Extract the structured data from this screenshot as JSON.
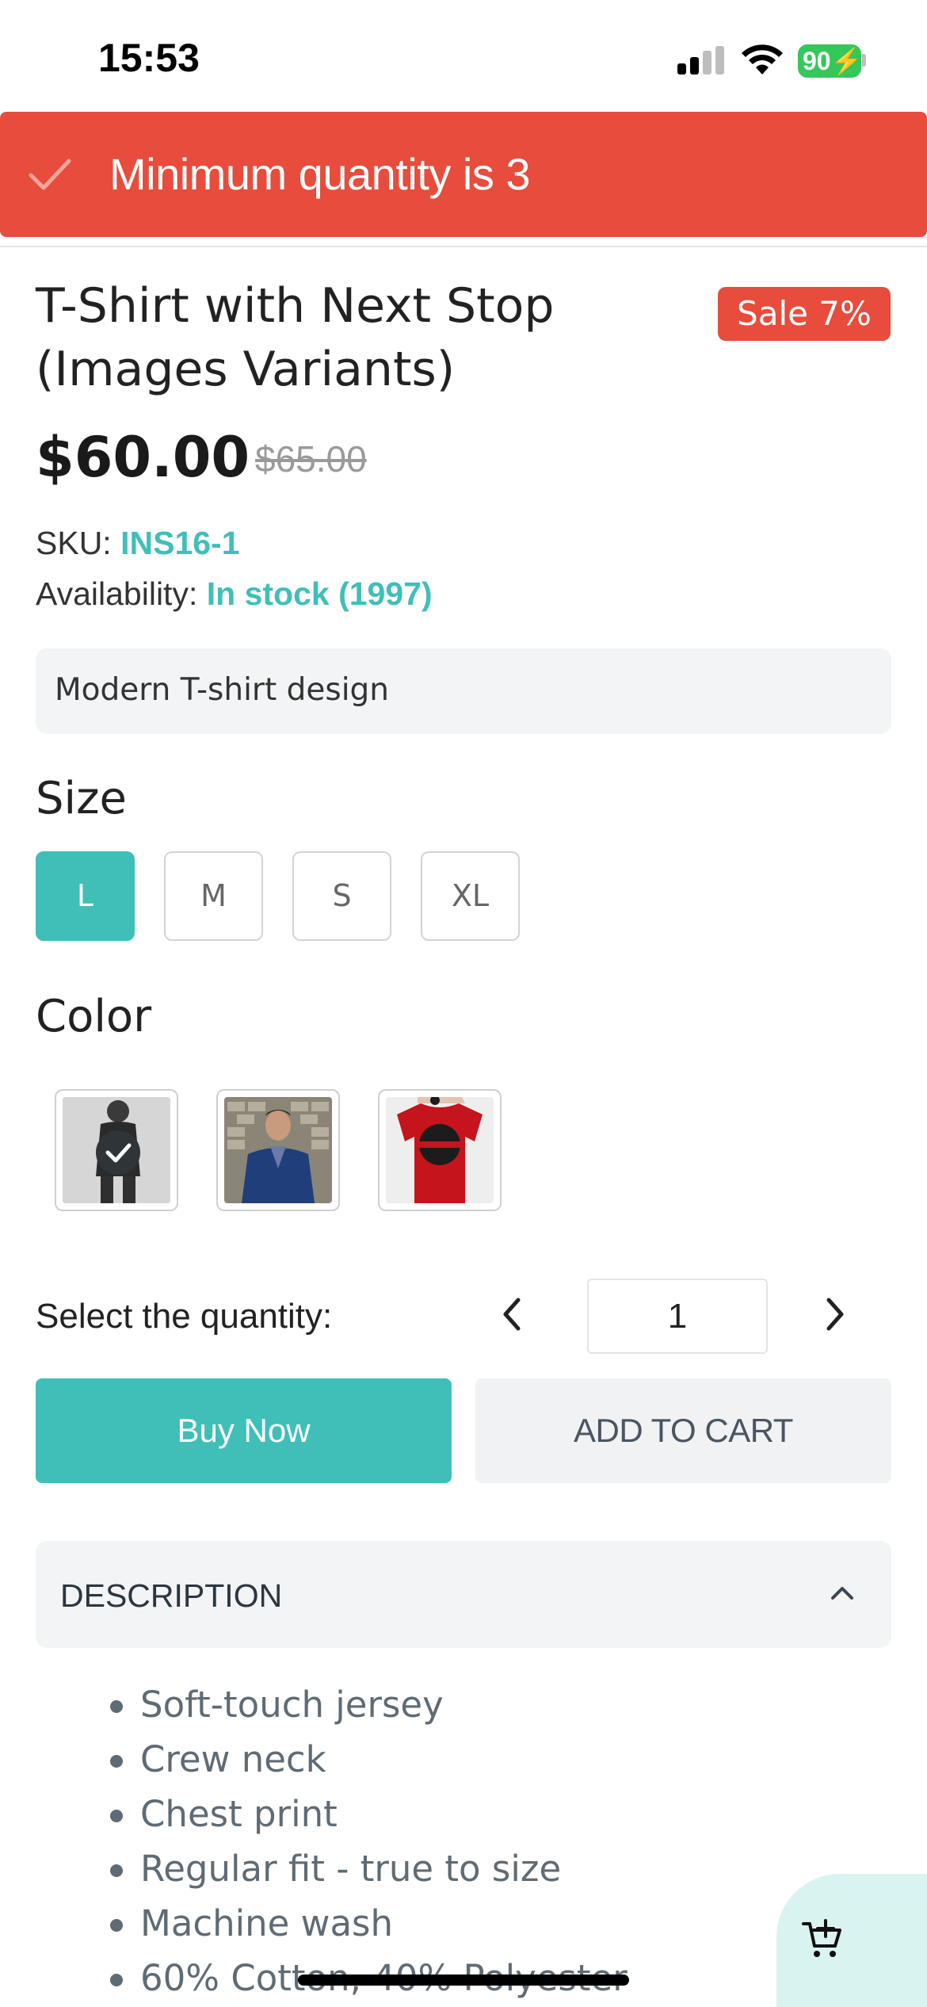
{
  "status_bar": {
    "time": "15:53",
    "battery": "90"
  },
  "toast": {
    "message": "Minimum quantity is 3",
    "icon": "check-icon"
  },
  "product": {
    "title": "T-Shirt with Next Stop (Images Variants)",
    "sale_badge": "Sale 7%",
    "price": "$60.00",
    "old_price": "$65.00",
    "sku_label": "SKU:",
    "sku": "INS16-1",
    "availability_label": "Availability:",
    "availability": "In stock",
    "stock_count": "(1997)",
    "short_description": "Modern T-shirt design"
  },
  "size": {
    "label": "Size",
    "options": [
      "L",
      "M",
      "S",
      "XL"
    ],
    "selected": "L"
  },
  "color": {
    "label": "Color",
    "swatches": [
      "variant-grey",
      "variant-blue-jacket",
      "variant-red"
    ],
    "selected": 0
  },
  "quantity": {
    "label": "Select the quantity:",
    "value": "1"
  },
  "buttons": {
    "buy_now": "Buy Now",
    "add_to_cart": "ADD TO CART"
  },
  "description": {
    "title": "DESCRIPTION",
    "items": [
      "Soft-touch jersey",
      "Crew neck",
      "Chest print",
      "Regular fit - true to size",
      "Machine wash",
      "60% Cotton, 40% Polyester"
    ]
  },
  "colors": {
    "accent": "#3fbfb8",
    "sale": "#e74c3c",
    "toast": "#e74c3c"
  }
}
